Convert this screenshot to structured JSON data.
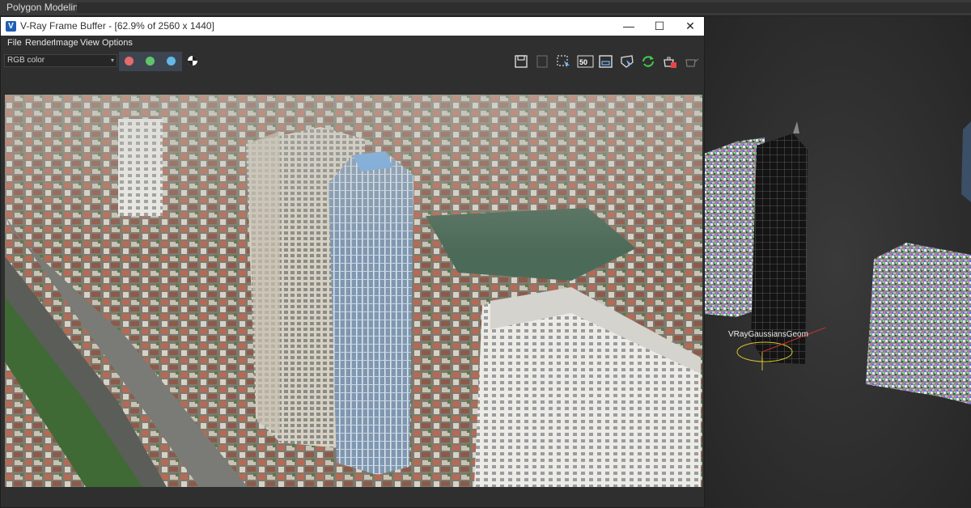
{
  "app": {
    "tab_title": "Polygon Modeling"
  },
  "vfb": {
    "title": "V-Ray Frame Buffer - [62.9% of 2560 x 1440]",
    "logo_letter": "V",
    "window_buttons": {
      "minimize": "—",
      "maximize": "☐",
      "close": "✕"
    },
    "menu": [
      "File",
      "Render",
      "Image",
      "View",
      "Options"
    ],
    "channel_select": {
      "value": "RGB color"
    },
    "channels": [
      {
        "name": "red-channel",
        "color": "#e86a6a"
      },
      {
        "name": "green-channel",
        "color": "#62c46a"
      },
      {
        "name": "blue-channel",
        "color": "#62b8e8"
      }
    ],
    "toolbar_icons": [
      "save-icon",
      "save-all-icon",
      "region-select-icon",
      "zoom-50-icon",
      "region-render-icon",
      "track-mouse-icon",
      "refresh-icon",
      "teapot-render-icon",
      "teapot-icon"
    ],
    "zoom_icon_text": "50"
  },
  "viewport": {
    "object_label": "VRayGaussiansGeom"
  },
  "colors": {
    "accent": "#1f5fb5",
    "background": "#2f2f2f",
    "titlebar": "#ffffff"
  }
}
